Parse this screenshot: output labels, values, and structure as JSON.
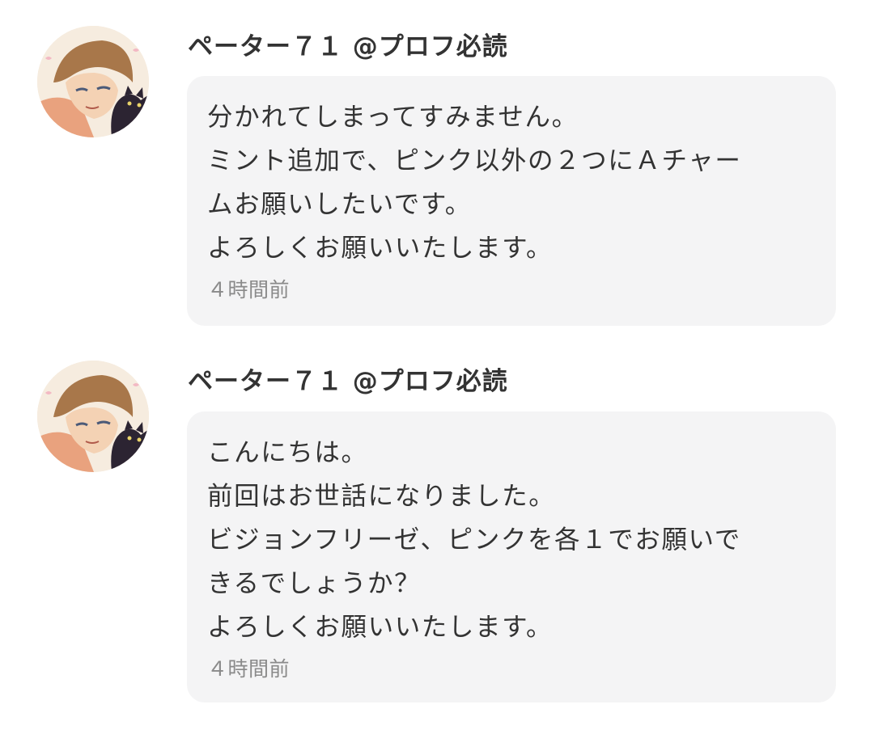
{
  "messages": [
    {
      "avatar": "user-avatar-illustration",
      "username": "ペーター７１ @プロフ必読",
      "lines": [
        "分かれてしまってすみません。",
        "ミント追加で、ピンク以外の２つにＡチャー",
        "ムお願いしたいです。",
        "よろしくお願いいたします。"
      ],
      "timestamp": "４時間前"
    },
    {
      "avatar": "user-avatar-illustration",
      "username": "ペーター７１ @プロフ必読",
      "lines": [
        "こんにちは。",
        "前回はお世話になりました。",
        "ビジョンフリーゼ、ピンクを各１でお願いで",
        "きるでしょうか？",
        "よろしくお願いいたします。"
      ],
      "timestamp": "４時間前"
    }
  ],
  "colors": {
    "bubble_background": "#f4f4f5",
    "text": "#333333",
    "timestamp": "#8a8a8a"
  }
}
